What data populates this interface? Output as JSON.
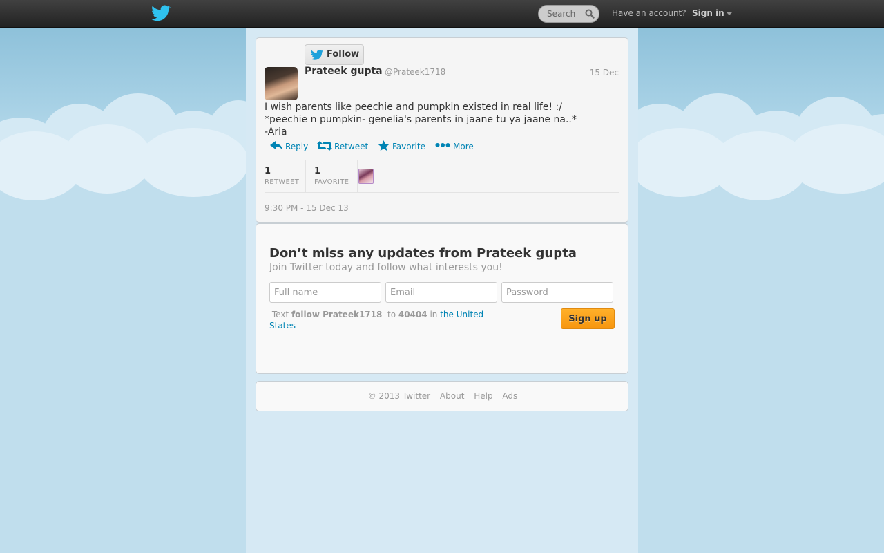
{
  "topbar": {
    "search_placeholder": "Search",
    "have_account": "Have an account?",
    "sign_in": "Sign in"
  },
  "tweet": {
    "follow_label": "Follow",
    "fullname": "Prateek gupta",
    "screenname": "@Prateek1718",
    "date": "15 Dec",
    "text_lines": [
      "I wish parents like peechie and pumpkin existed in real life! :/",
      "*peechie n pumpkin- genelia's parents in jaane tu ya jaane na..*",
      "-Aria"
    ],
    "actions": {
      "reply": "Reply",
      "retweet": "Retweet",
      "favorite": "Favorite",
      "more": "More"
    },
    "stats": {
      "retweets": "1",
      "retweets_label": "RETWEET",
      "favorites": "1",
      "favorites_label": "FAVORITE"
    },
    "timestamp": "9:30 PM - 15 Dec 13"
  },
  "signup": {
    "title": "Don’t miss any updates from Prateek gupta",
    "subtitle": "Join Twitter today and follow what interests you!",
    "fullname_placeholder": "Full name",
    "email_placeholder": "Email",
    "password_placeholder": "Password",
    "sms_text_prefix": "Text",
    "sms_command": "follow Prateek1718",
    "sms_to": "to",
    "sms_number": "40404",
    "sms_in": "in",
    "sms_country": "the United States",
    "button": "Sign up"
  },
  "footer": {
    "copyright": "© 2013 Twitter",
    "about": "About",
    "help": "Help",
    "ads": "Ads"
  },
  "colors": {
    "link": "#0084b4",
    "signup_button": "#f7960f",
    "topbar": "#2b2b2b",
    "background": "#c0deed"
  }
}
